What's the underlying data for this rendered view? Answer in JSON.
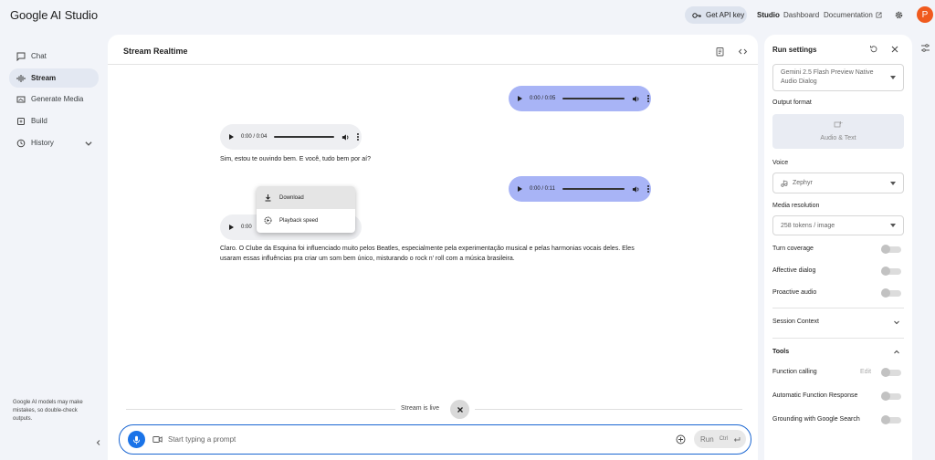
{
  "app": {
    "title": "Google AI Studio",
    "api_key_button": "Get API key",
    "nav": {
      "studio": "Studio",
      "dashboard": "Dashboard",
      "documentation": "Documentation"
    },
    "avatar_letter": "P",
    "avatar_color": "#f05a1e"
  },
  "sidebar": {
    "items": [
      {
        "label": "Chat",
        "icon": "chat-icon"
      },
      {
        "label": "Stream",
        "icon": "stream-icon",
        "active": true
      },
      {
        "label": "Generate Media",
        "icon": "media-icon"
      },
      {
        "label": "Build",
        "icon": "build-icon"
      },
      {
        "label": "History",
        "icon": "history-icon"
      }
    ],
    "disclaimer": "Google AI models may make mistakes, so double-check outputs."
  },
  "main": {
    "title": "Stream Realtime",
    "messages": [
      {
        "role": "user",
        "audio_time": "0:00 / 0:05"
      },
      {
        "role": "model",
        "audio_time": "0:00 / 0:04",
        "text": "Sim, estou te ouvindo bem. E você, tudo bem por aí?"
      },
      {
        "role": "user",
        "audio_time": "0:00 / 0:11"
      },
      {
        "role": "model",
        "audio_time": "0:00",
        "text": "Claro. O Clube da Esquina foi influenciado muito pelos Beatles, especialmente pela experimentação musical e pelas harmonias vocais deles. Eles usaram essas influências pra criar um som bem único, misturando o rock n' roll com a música brasileira."
      }
    ],
    "context_menu": {
      "download": "Download",
      "playback_speed": "Playback speed"
    },
    "stream_status": "Stream is live",
    "prompt": {
      "placeholder": "Start typing a prompt",
      "run_label": "Run",
      "run_shortcut": "Ctrl"
    }
  },
  "run_settings": {
    "title": "Run settings",
    "model": "Gemini 2.5 Flash Preview Native Audio Dialog",
    "output_format_label": "Output format",
    "output_format_value": "Audio & Text",
    "voice_label": "Voice",
    "voice_value": "Zephyr",
    "media_resolution_label": "Media resolution",
    "media_resolution_value": "258 tokens / image",
    "turn_coverage": "Turn coverage",
    "affective_dialog": "Affective dialog",
    "proactive_audio": "Proactive audio",
    "session_context": "Session Context",
    "tools": "Tools",
    "function_calling": "Function calling",
    "function_calling_edit": "Edit",
    "automatic_function_response": "Automatic Function Response",
    "grounding": "Grounding with Google Search"
  },
  "colors": {
    "user_bubble": "#a8b4f6",
    "model_bubble": "#eeeff2",
    "accent": "#1a73e8"
  }
}
